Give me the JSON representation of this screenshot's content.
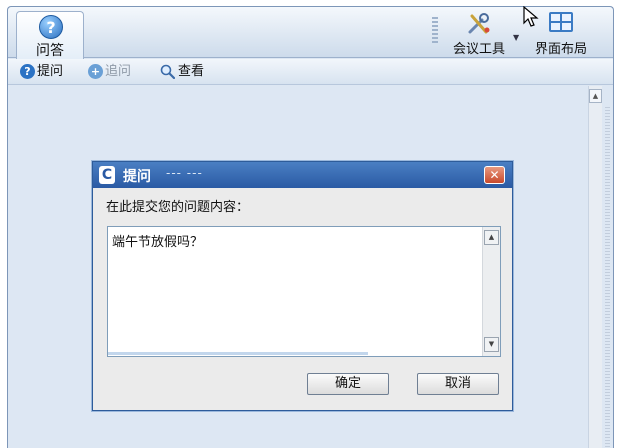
{
  "topbar": {
    "tab_qa": {
      "label": "问答",
      "icon": "question-icon"
    },
    "meeting_tools": {
      "label": "会议工具",
      "icon": "tools-icon"
    },
    "layout": {
      "label": "界面布局",
      "icon": "layout-grid-icon"
    }
  },
  "toolbar": {
    "ask": {
      "label": "提问",
      "icon": "question-icon"
    },
    "follow_up": {
      "label": "追问",
      "icon": "add-icon"
    },
    "view": {
      "label": "查看",
      "icon": "magnifier-icon"
    }
  },
  "dialog": {
    "title": "提问",
    "title_suffix": "--- ---",
    "prompt": "在此提交您的问题内容：",
    "question_text": "端午节放假吗？",
    "ok_label": "确定",
    "cancel_label": "取消",
    "close_glyph": "✕"
  },
  "colors": {
    "title_bar": "#2a5aa4",
    "frame_bg": "#dde7f3",
    "close_button": "#c84a2c"
  }
}
